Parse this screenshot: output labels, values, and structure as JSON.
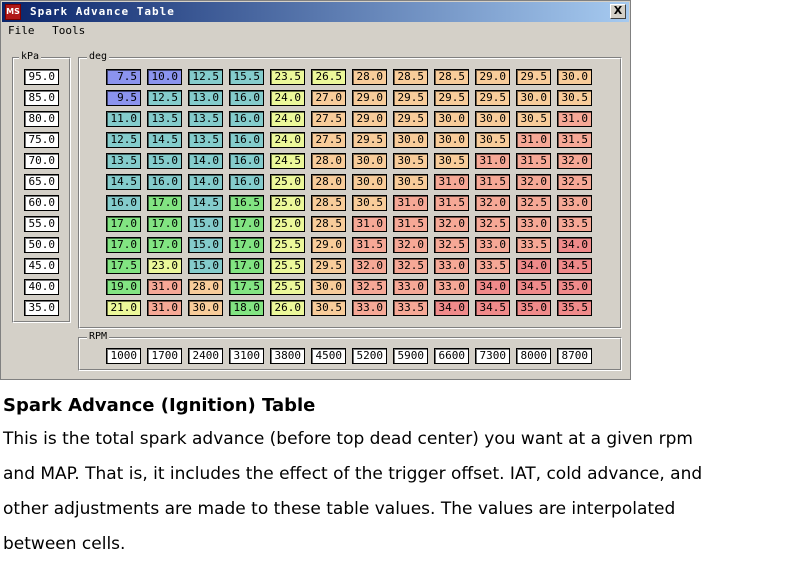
{
  "window": {
    "title": "Spark Advance Table",
    "icon": "app-icon",
    "close_label": "X"
  },
  "menu": [
    "File",
    "Tools"
  ],
  "kpa_group": {
    "label": "kPa",
    "values": [
      "95.0",
      "85.0",
      "80.0",
      "75.0",
      "70.0",
      "65.0",
      "60.0",
      "55.0",
      "50.0",
      "45.0",
      "40.0",
      "35.0"
    ]
  },
  "deg_group": {
    "label": "deg",
    "rows": [
      [
        "7.5",
        "10.0",
        "12.5",
        "15.5",
        "23.5",
        "26.5",
        "28.0",
        "28.5",
        "28.5",
        "29.0",
        "29.5",
        "30.0"
      ],
      [
        "9.5",
        "12.5",
        "13.0",
        "16.0",
        "24.0",
        "27.0",
        "29.0",
        "29.5",
        "29.5",
        "29.5",
        "30.0",
        "30.5"
      ],
      [
        "11.0",
        "13.5",
        "13.5",
        "16.0",
        "24.0",
        "27.5",
        "29.0",
        "29.5",
        "30.0",
        "30.0",
        "30.5",
        "31.0"
      ],
      [
        "12.5",
        "14.5",
        "13.5",
        "16.0",
        "24.0",
        "27.5",
        "29.5",
        "30.0",
        "30.0",
        "30.5",
        "31.0",
        "31.5"
      ],
      [
        "13.5",
        "15.0",
        "14.0",
        "16.0",
        "24.5",
        "28.0",
        "30.0",
        "30.5",
        "30.5",
        "31.0",
        "31.5",
        "32.0"
      ],
      [
        "14.5",
        "16.0",
        "14.0",
        "16.0",
        "25.0",
        "28.0",
        "30.0",
        "30.5",
        "31.0",
        "31.5",
        "32.0",
        "32.5"
      ],
      [
        "16.0",
        "17.0",
        "14.5",
        "16.5",
        "25.0",
        "28.5",
        "30.5",
        "31.0",
        "31.5",
        "32.0",
        "32.5",
        "33.0"
      ],
      [
        "17.0",
        "17.0",
        "15.0",
        "17.0",
        "25.0",
        "28.5",
        "31.0",
        "31.5",
        "32.0",
        "32.5",
        "33.0",
        "33.5"
      ],
      [
        "17.0",
        "17.0",
        "15.0",
        "17.0",
        "25.5",
        "29.0",
        "31.5",
        "32.0",
        "32.5",
        "33.0",
        "33.5",
        "34.0"
      ],
      [
        "17.5",
        "23.0",
        "15.0",
        "17.0",
        "25.5",
        "29.5",
        "32.0",
        "32.5",
        "33.0",
        "33.5",
        "34.0",
        "34.5"
      ],
      [
        "19.0",
        "31.0",
        "28.0",
        "17.5",
        "25.5",
        "30.0",
        "32.5",
        "33.0",
        "33.0",
        "34.0",
        "34.5",
        "35.0"
      ],
      [
        "21.0",
        "31.0",
        "30.0",
        "18.0",
        "26.0",
        "30.5",
        "33.0",
        "33.5",
        "34.0",
        "34.5",
        "35.0",
        "35.5"
      ]
    ]
  },
  "rpm_group": {
    "label": "RPM",
    "values": [
      "1000",
      "1700",
      "2400",
      "3100",
      "3800",
      "4500",
      "5200",
      "5900",
      "6600",
      "7300",
      "8000",
      "8700"
    ]
  },
  "color_scale": [
    {
      "max": 10.5,
      "color": "#8b93ee"
    },
    {
      "max": 16.0,
      "color": "#84cccc"
    },
    {
      "max": 19.5,
      "color": "#82e482"
    },
    {
      "max": 26.5,
      "color": "#ecf89a"
    },
    {
      "max": 30.75,
      "color": "#f8cc9a"
    },
    {
      "max": 33.75,
      "color": "#f6a896"
    },
    {
      "max": 99,
      "color": "#f08a8a"
    }
  ],
  "caption": {
    "heading": "Spark Advance (Ignition) Table",
    "paragraph_lines": [
      "This is the total spark advance (before top dead center) you want at a given rpm",
      "and MAP. That is, it includes the effect of the trigger offset. IAT, cold advance, and",
      "other adjustments are made to these table values. The values are interpolated",
      "between cells."
    ]
  }
}
